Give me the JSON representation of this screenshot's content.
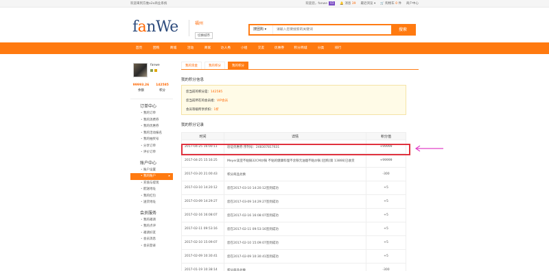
{
  "topbar": {
    "welcome": "欢迎来到方维o2o商业系统",
    "greeting": "欢迎您，fanwe",
    "badge": "V3",
    "messages_label": "消息",
    "messages_count": "39",
    "recent": "最近浏览",
    "cart_label": "购物车",
    "cart_count": "0",
    "cart_unit": "件",
    "merchant": "商户中心"
  },
  "header": {
    "logo_left": "f",
    "logo_o": "a",
    "logo_right": "nWe",
    "city": "福州",
    "switch_city": "切换城市",
    "search_type": "搜团购",
    "search_placeholder": "请输入您要搜索的关键词",
    "search_button": "搜索"
  },
  "nav": [
    "首页",
    "团购",
    "商城",
    "活动",
    "商家",
    "达人秀",
    "小组",
    "交友",
    "优惠券",
    "积分商城",
    "分类",
    "排行"
  ],
  "profile": {
    "username": "fanwe",
    "balance": "99993.26",
    "balance_label": "余额",
    "points": "142585",
    "points_label": "积分"
  },
  "menu": [
    {
      "title": "订单中心",
      "items": [
        "我的订单",
        "我的消费券",
        "我的优惠券",
        "我的活动报名",
        "我的抽奖号",
        "分享订单",
        "评价订单"
      ]
    },
    {
      "title": "账户中心",
      "items": [
        "账户设置",
        "我的账户",
        "充值与提现",
        "配送地址",
        "我的红包",
        "送货地址"
      ]
    },
    {
      "title": "会员服务",
      "items": [
        "我的邀请",
        "我的点评",
        "邀请好友",
        "会员消息",
        "会员登录"
      ]
    }
  ],
  "tabs": [
    "我的资金",
    "我的积分",
    "我的积分"
  ],
  "info": {
    "title": "我的积分信息",
    "line1_label": "您当前的积分是：",
    "line1_value": "142585",
    "line2_label": "您当前所在的会员组：",
    "line2_value": "VIP会员",
    "line3_label": "会员等级所享折扣：",
    "line3_value": "1折"
  },
  "records": {
    "title": "我的积分记录",
    "headers": [
      "时间",
      "详情",
      "积分值"
    ],
    "rows": [
      {
        "time": "2017-04-25 16:00:11",
        "detail": "验证优惠券 序列号：248307817631",
        "points": "+99999"
      },
      {
        "time": "2017-04-25 15:16:25",
        "detail": "Meyer美亚不粘锅32CM炒锅 不粘的健康料理不含铁元油烟不粘炒锅 [团购]第 13866[已收货",
        "points": "+99999"
      },
      {
        "time": "2017-03-20 21:00:43",
        "detail": "积分商品兑换",
        "points": "-300"
      },
      {
        "time": "2017-03-10 14:20:12",
        "detail": "您在2017-03-10 14:20:12签到成功",
        "points": "+5"
      },
      {
        "time": "2017-03-09 14:29:27",
        "detail": "您在2017-03-09 14:29:27签到成功",
        "points": "+5"
      },
      {
        "time": "2017-02-16 16:08:07",
        "detail": "您在2017-02-16 16:08:07签到成功",
        "points": "+5"
      },
      {
        "time": "2017-02-11 09:53:16",
        "detail": "您在2017-02-11 09:53:16签到成功",
        "points": "+5"
      },
      {
        "time": "2017-02-10 15:09:07",
        "detail": "您在2017-02-10 15:09:07签到成功",
        "points": "+5"
      },
      {
        "time": "2017-02-09 10:30:41",
        "detail": "您在2017-02-09 10:30:41签到成功",
        "points": "+5"
      },
      {
        "time": "2017-01-19 10:38:14",
        "detail": "积分商品兑换",
        "points": "-300"
      }
    ]
  },
  "colors": {
    "accent": "#ff7a10",
    "highlight": "#e0303c",
    "arrow": "#e040c8"
  }
}
